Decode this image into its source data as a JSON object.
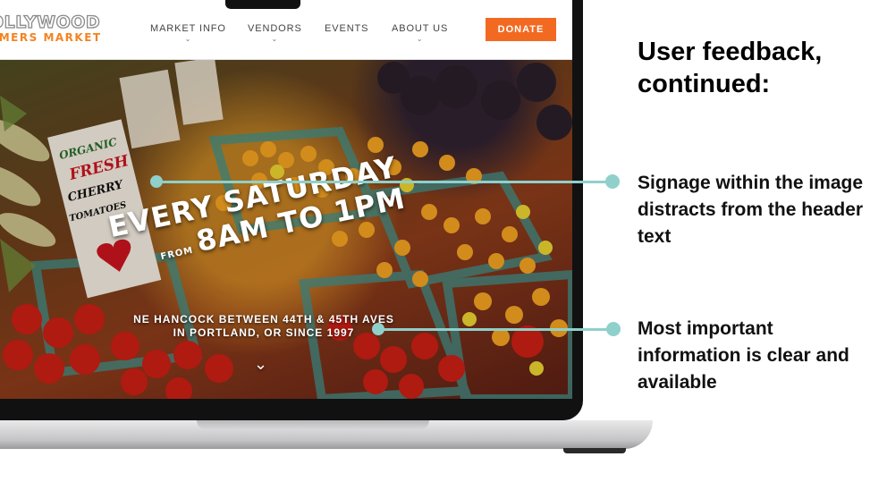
{
  "site": {
    "logo_top": "OLLYWOOD",
    "logo_bottom": "RMERS MARKET",
    "nav": [
      {
        "label": "MARKET INFO",
        "has_dropdown": true
      },
      {
        "label": "VENDORS",
        "has_dropdown": true
      },
      {
        "label": "EVENTS",
        "has_dropdown": false
      },
      {
        "label": "ABOUT US",
        "has_dropdown": true
      }
    ],
    "donate_label": "DONATE",
    "accent_color": "#f26a21"
  },
  "hero": {
    "title_line1": "EVERY SATURDAY",
    "title_from": "FROM",
    "title_line2": "8AM TO 1PM",
    "subtitle_line1": "NE HANCOCK BETWEEN 44TH & 45TH AVES",
    "subtitle_line2": "IN PORTLAND, OR SINCE 1997",
    "scroll_icon": "chevron-down-icon",
    "sign": {
      "line1": "ORGANIC",
      "line2": "FRESH",
      "line3": "CHERRY",
      "line4": "TOMATOES"
    }
  },
  "annotations": {
    "title": "User feedback, continued:",
    "notes": [
      "Signage within the image distracts from the header text",
      "Most important information is clear and available"
    ],
    "connector_color": "#8fd0cb"
  }
}
